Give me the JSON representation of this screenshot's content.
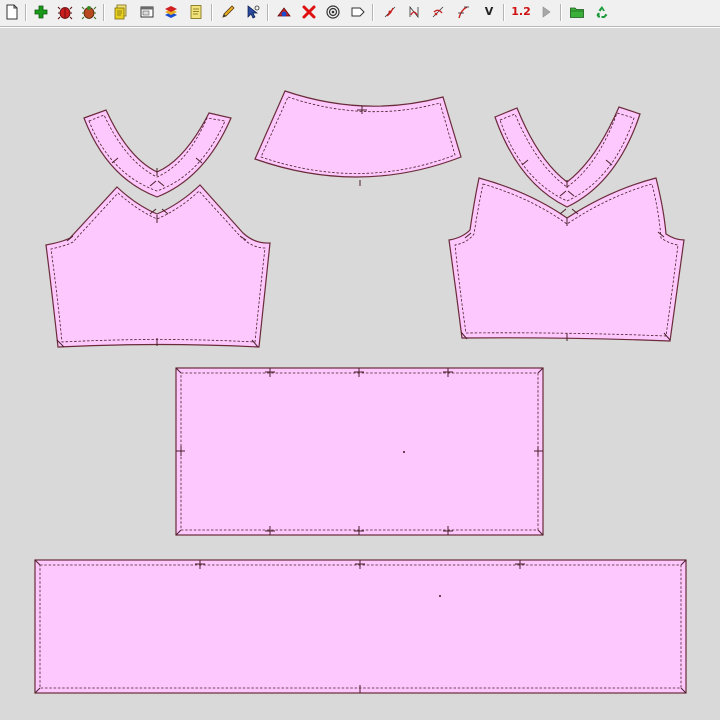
{
  "toolbar": {
    "buttons": [
      {
        "id": "new",
        "icon": "new-document-icon",
        "color": "#ffffff"
      },
      {
        "id": "add-piece",
        "icon": "green-plus-icon",
        "color": "#1a9a1a"
      },
      {
        "id": "delete-piece",
        "icon": "red-bug-icon",
        "color": "#c81e1e"
      },
      {
        "id": "mirror-piece",
        "icon": "mixed-bug-icon",
        "color": "#b8481e"
      },
      {
        "id": "copy",
        "icon": "copy-pages-icon",
        "color": "#e8d020"
      },
      {
        "id": "window",
        "icon": "window-icon",
        "color": "#ffffff"
      },
      {
        "id": "layers",
        "icon": "colored-layers-icon",
        "color": "#d02020"
      },
      {
        "id": "notes",
        "icon": "yellow-note-icon",
        "color": "#f2e27a"
      },
      {
        "id": "pencil",
        "icon": "pencil-icon",
        "color": "#d9a020"
      },
      {
        "id": "select",
        "icon": "select-cursor-icon",
        "color": "#2a4aa0"
      },
      {
        "id": "points",
        "icon": "point-shape-icon",
        "color": "#d02020"
      },
      {
        "id": "delete-point",
        "icon": "red-x-icon",
        "color": "#e01010"
      },
      {
        "id": "target",
        "icon": "target-icon",
        "color": "#333333"
      },
      {
        "id": "label",
        "icon": "label-tag-icon",
        "color": "#333333"
      },
      {
        "id": "curve-1",
        "icon": "curve-tool-1-icon",
        "color": "#c81e1e"
      },
      {
        "id": "curve-2",
        "icon": "curve-tool-2-icon",
        "color": "#c81e1e"
      },
      {
        "id": "curve-3",
        "icon": "curve-tool-3-icon",
        "color": "#c81e1e"
      },
      {
        "id": "curve-4",
        "icon": "curve-tool-4-icon",
        "color": "#c81e1e"
      },
      {
        "id": "v-tool",
        "icon": "v-letter-icon",
        "color": "#222222"
      },
      {
        "id": "scale",
        "icon": "scale-text-icon",
        "color": "#d01010"
      },
      {
        "id": "play",
        "icon": "play-arrow-icon",
        "color": "#a0a0a0"
      },
      {
        "id": "open-folder",
        "icon": "green-folder-icon",
        "color": "#2aa02a"
      },
      {
        "id": "recycle",
        "icon": "recycle-icon",
        "color": "#1a9a3a"
      }
    ],
    "v_label": "V",
    "scale_label": "1.2"
  },
  "canvas": {
    "background": "#d9d9d9",
    "piece_fill": "#fdc8fd",
    "piece_outline": "#6b2b3a"
  },
  "pattern_pieces": [
    {
      "id": "front-neckband",
      "name": "front-neckband-piece"
    },
    {
      "id": "front-bodice",
      "name": "front-bodice-piece"
    },
    {
      "id": "back-band",
      "name": "back-band-piece"
    },
    {
      "id": "back-neckband",
      "name": "back-neckband-piece"
    },
    {
      "id": "back-bodice",
      "name": "back-bodice-piece"
    },
    {
      "id": "waistband",
      "name": "waistband-piece"
    },
    {
      "id": "skirt-panel",
      "name": "skirt-panel-piece"
    }
  ]
}
